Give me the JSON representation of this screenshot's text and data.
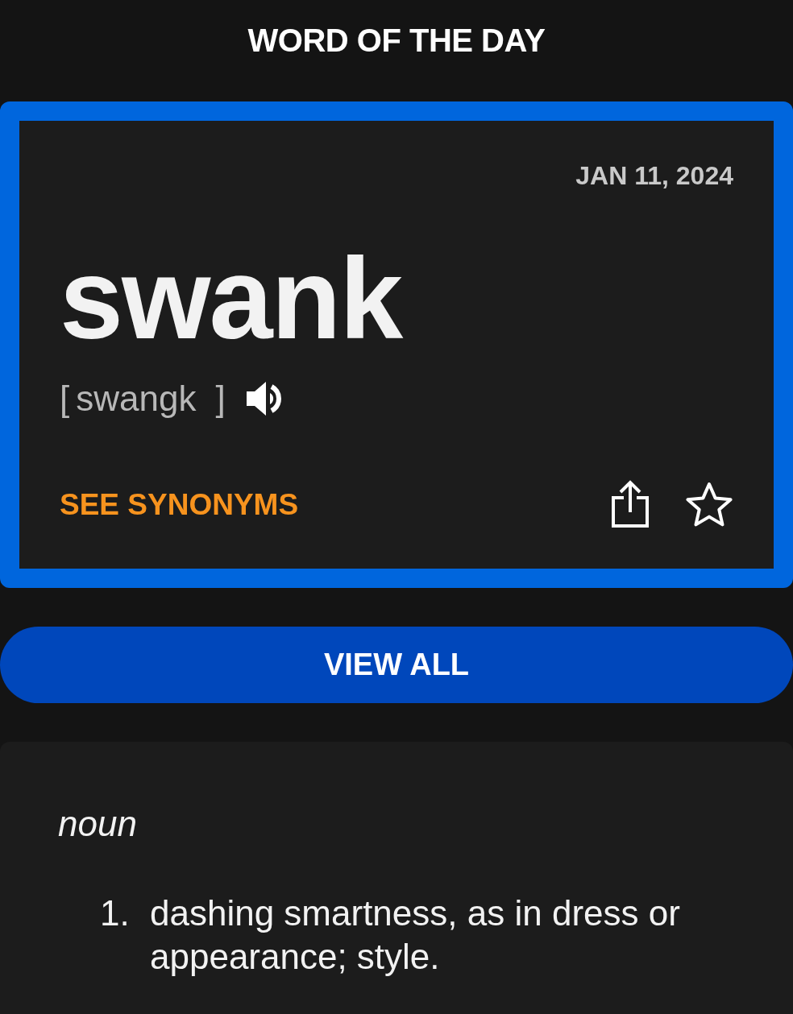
{
  "header": {
    "title": "WORD OF THE DAY"
  },
  "card": {
    "date": "JAN 11, 2024",
    "word": "swank",
    "bracket_open": "[",
    "pronunciation": "swangk",
    "bracket_close": "]",
    "synonyms_link": "SEE SYNONYMS",
    "saved": false
  },
  "view_all_button": "VIEW ALL",
  "definition": {
    "part_of_speech": "noun",
    "senses": [
      {
        "number": "1.",
        "text": "dashing smartness, as in dress or appearance; style."
      }
    ]
  }
}
